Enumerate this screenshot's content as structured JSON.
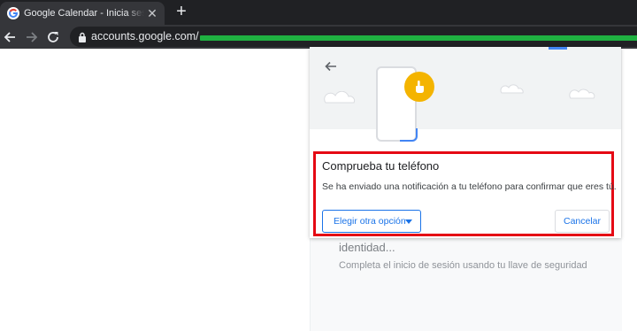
{
  "browser": {
    "tab_title": "Google Calendar - Inicia sesión p",
    "url_text": "accounts.google.com/",
    "colors": {
      "redaction": "#1fb141",
      "highlight": "#e50914"
    }
  },
  "dialog": {
    "title": "Comprueba tu teléfono",
    "message": "Se ha enviado una notificación a tu teléfono para confirmar que eres tú.",
    "choose_other_label": "Elegir otra opción",
    "cancel_label": "Cancelar"
  },
  "background_page": {
    "heading": "Verificación en dos pasos: Verificando tu identidad...",
    "subtext": "Completa el inicio de sesión usando tu llave de seguridad"
  },
  "icons": [
    "google-favicon-icon",
    "close-icon",
    "plus-icon",
    "back-arrow-icon",
    "forward-arrow-icon",
    "reload-icon",
    "lock-icon",
    "phone-icon",
    "tap-hand-icon",
    "chevron-down-icon"
  ]
}
